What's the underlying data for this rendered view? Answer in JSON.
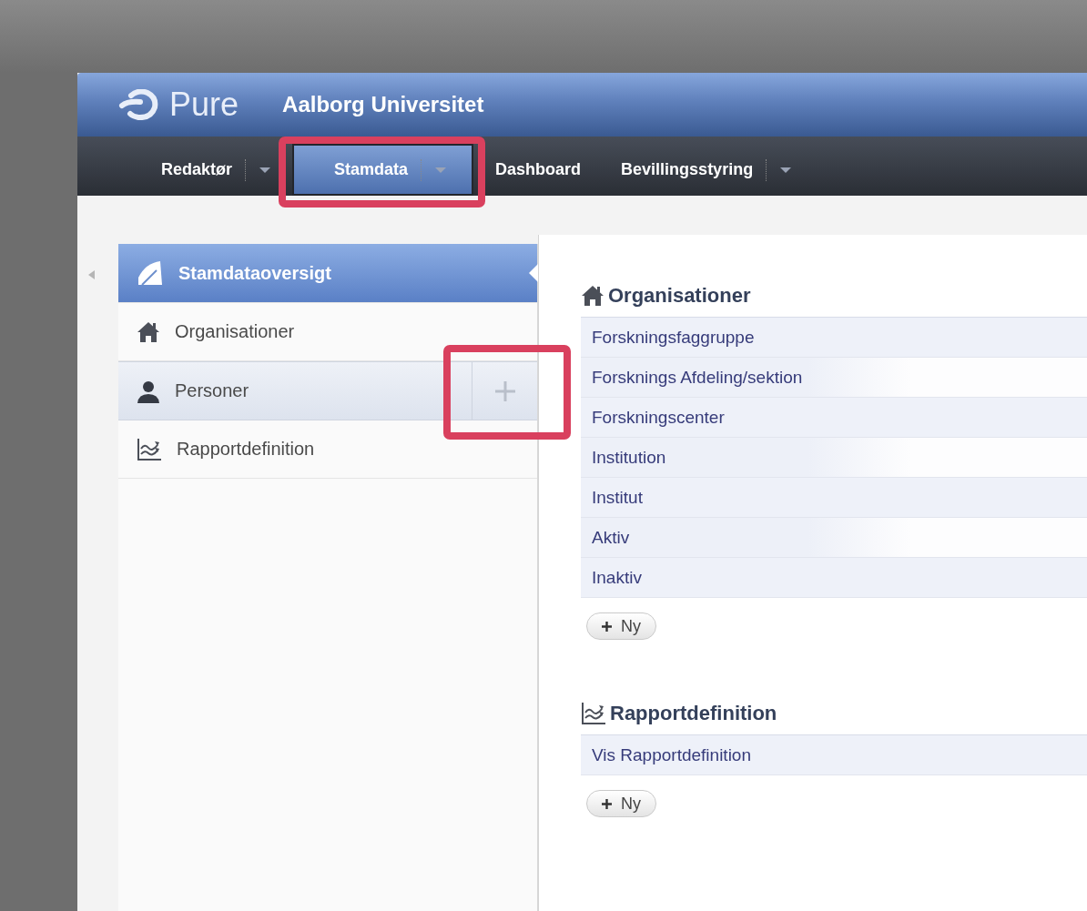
{
  "app": {
    "logo": "Pure",
    "institution": "Aalborg Universitet"
  },
  "nav_tabs": [
    {
      "label": "Redaktør",
      "selected": false,
      "has_menu": true,
      "highlighted": false
    },
    {
      "label": "Stamdata",
      "selected": true,
      "has_menu": true,
      "highlighted": true
    },
    {
      "label": "Dashboard",
      "selected": false,
      "has_menu": false,
      "highlighted": false
    },
    {
      "label": "Bevillingsstyring",
      "selected": false,
      "has_menu": true,
      "highlighted": false
    }
  ],
  "sidebar": {
    "items": [
      {
        "label": "Stamdataoversigt",
        "selected": true,
        "hovered": false,
        "add_highlighted": false
      },
      {
        "label": "Organisationer",
        "selected": false,
        "hovered": false,
        "add_highlighted": false
      },
      {
        "label": "Personer",
        "selected": false,
        "hovered": true,
        "add_highlighted": true
      },
      {
        "label": "Rapportdefinition",
        "selected": false,
        "hovered": false,
        "add_highlighted": false
      }
    ]
  },
  "sections": [
    {
      "title": "Organisationer",
      "rows": [
        "Forskningsfaggruppe",
        "Forsknings Afdeling/sektion",
        "Forskningscenter",
        "Institution",
        "Institut",
        "Aktiv",
        "Inaktiv"
      ],
      "new_button": "Ny"
    },
    {
      "title": "Rapportdefinition",
      "rows": [
        "Vis Rapportdefinition"
      ],
      "new_button": "Ny"
    }
  ]
}
